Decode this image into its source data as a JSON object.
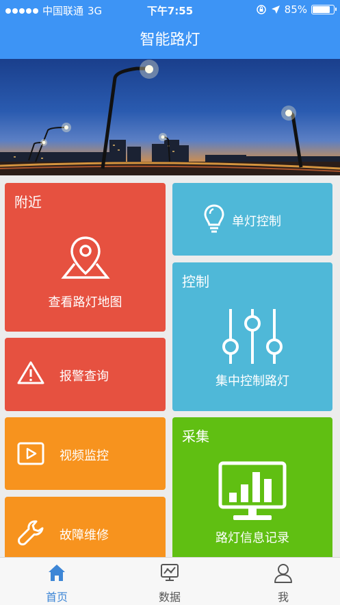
{
  "status_bar": {
    "carrier": "中国联通",
    "network": "3G",
    "time": "下午7:55",
    "battery_percent": "85%",
    "battery_level": 0.85
  },
  "header": {
    "title": "智能路灯"
  },
  "tiles": {
    "nearby": {
      "title": "附近",
      "label": "查看路灯地图",
      "icon": "map-pin-icon"
    },
    "single_light": {
      "label": "单灯控制",
      "icon": "lightbulb-icon"
    },
    "control": {
      "title": "控制",
      "label": "集中控制路灯",
      "icon": "sliders-icon"
    },
    "alarm": {
      "label": "报警查询",
      "icon": "warning-icon"
    },
    "video": {
      "label": "视频监控",
      "icon": "video-icon"
    },
    "repair": {
      "label": "故障维修",
      "icon": "wrench-icon"
    },
    "collect": {
      "title": "采集",
      "label": "路灯信息记录",
      "icon": "monitor-chart-icon"
    }
  },
  "colors": {
    "header": "#3d94f5",
    "red": "#e65140",
    "blue": "#4fb8d8",
    "orange": "#f7931e",
    "green": "#60bf12",
    "tab_active": "#3d86d6",
    "tab_inactive": "#555555"
  },
  "tabbar": [
    {
      "label": "首页",
      "icon": "home-icon",
      "active": true
    },
    {
      "label": "数据",
      "icon": "data-icon",
      "active": false
    },
    {
      "label": "我",
      "icon": "user-icon",
      "active": false
    }
  ]
}
